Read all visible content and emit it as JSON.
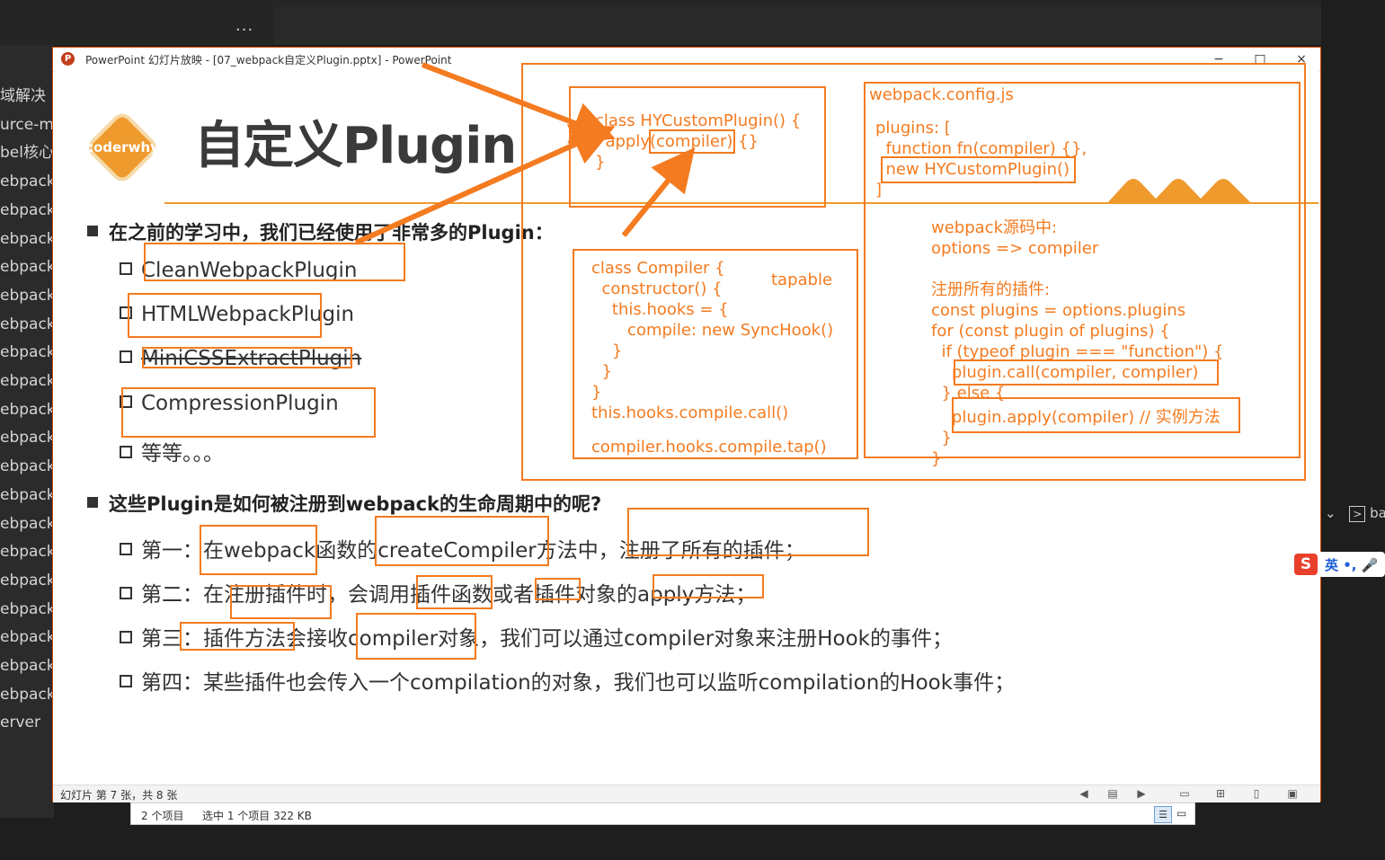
{
  "desktop": {
    "dots": "...",
    "sidebar_items": [
      "域解决",
      "urce-m",
      "bel核心",
      "ebpack",
      "ebpack",
      "ebpack",
      "ebpack",
      "ebpack",
      "ebpack",
      "ebpack",
      "ebpack",
      "ebpack",
      "ebpack",
      "ebpack",
      "ebpack",
      "ebpack",
      "ebpack",
      "ebpack",
      "ebpack",
      "ebpack-",
      "ebpack-",
      "ebpack-",
      "erver"
    ],
    "right_label": "ba"
  },
  "window": {
    "title": "PowerPoint 幻灯片放映 - [07_webpack自定义Plugin.pptx] - PowerPoint",
    "minimize": "−",
    "maximize": "□",
    "close": "×",
    "status": "幻灯片 第 7 张，共 8 张"
  },
  "slide": {
    "badge": "coderwhy",
    "title": "自定义Plugin",
    "bullet1": "在之前的学习中，我们已经使用了非常多的Plugin：",
    "plugins": [
      "CleanWebpackPlugin",
      "HTMLWebpackPlugin",
      "MiniCSSExtractPlugin",
      "CompressionPlugin",
      "等等。。。"
    ],
    "bullet2": "这些Plugin是如何被注册到webpack的生命周期中的呢?",
    "steps": [
      "第一：在webpack函数的createCompiler方法中，注册了所有的插件；",
      "第二：在注册插件时，会调用插件函数或者插件对象的apply方法；",
      "第三：插件方法会接收compiler对象，我们可以通过compiler对象来注册Hook的事件；",
      "第四：某些插件也会传入一个compilation的对象，我们也可以监听compilation的Hook事件；"
    ]
  },
  "annotations": {
    "plugin_class": [
      "class HYCustomPlugin() {",
      "  apply(compiler) {}",
      "}"
    ],
    "compiler_class": [
      "class Compiler {",
      "  constructor() {",
      "    this.hooks = {",
      "       compile: new SyncHook()",
      "    }",
      "  }",
      "}",
      "this.hooks.compile.call()",
      "compiler.hooks.compile.tap()"
    ],
    "tapable": "tapable",
    "config": [
      "webpack.config.js",
      "plugins: [",
      "  function fn(compiler) {},",
      "  new HYCustomPlugin()",
      "]"
    ],
    "source": [
      "webpack源码中:",
      "options => compiler",
      "",
      "注册所有的插件:",
      "const plugins = options.plugins",
      "for (const plugin of plugins) {",
      "  if (typeof plugin === \"function\") {",
      "    plugin.call(compiler, compiler)",
      "  } else {",
      "    plugin.apply(compiler) // 实例方法",
      "  }",
      "}"
    ]
  },
  "explorer": {
    "count": "2 个项目",
    "selected": "选中 1 个项目  322 KB"
  },
  "ime": {
    "logo": "S",
    "text": "英 •, 🎤"
  },
  "colors": {
    "accent": "#f47b20",
    "badge": "#ef9a2d"
  }
}
